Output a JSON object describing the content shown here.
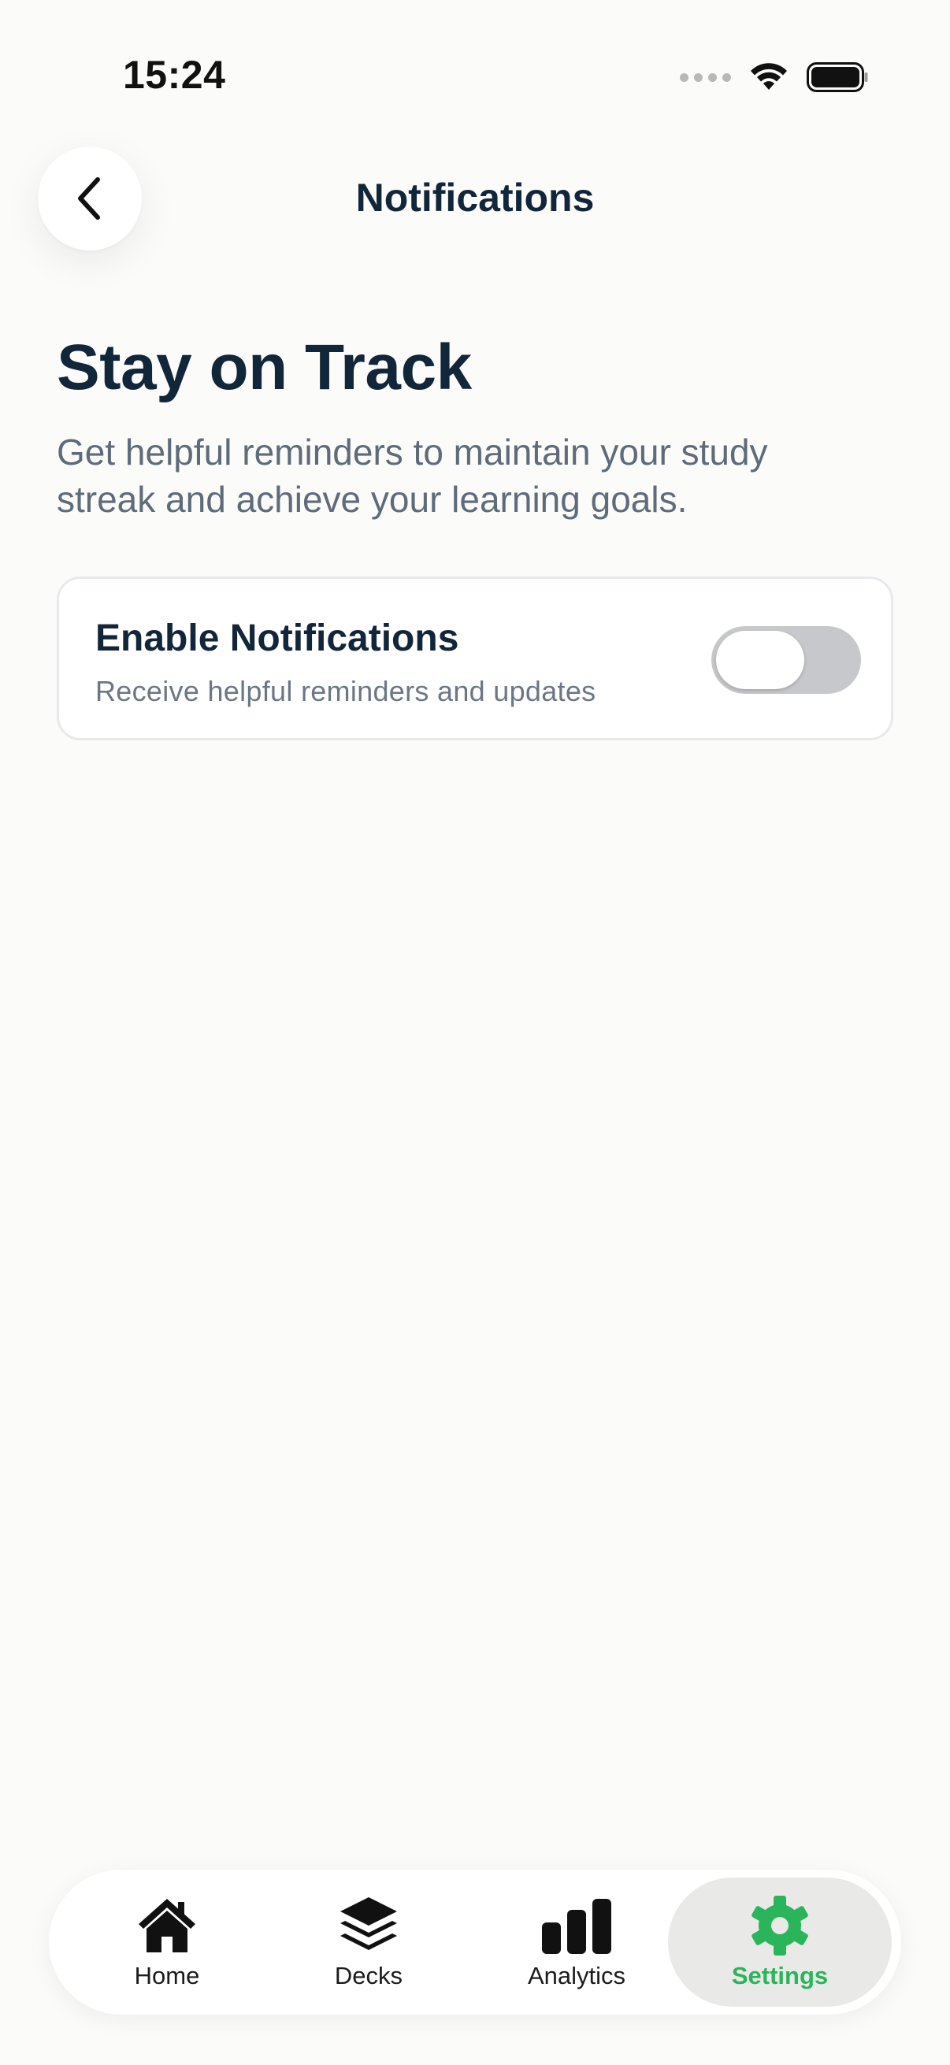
{
  "status_bar": {
    "time": "15:24",
    "icons": [
      "cellular-signal-icon",
      "wifi-icon",
      "battery-icon"
    ]
  },
  "header": {
    "title": "Notifications",
    "back_icon": "chevron-left-icon"
  },
  "hero": {
    "title": "Stay on Track",
    "subtitle": "Get helpful reminders to maintain your study streak and achieve your learning goals."
  },
  "notification_card": {
    "title": "Enable Notifications",
    "subtitle": "Receive helpful reminders and updates",
    "toggle_enabled": false
  },
  "tab_bar": {
    "active_tab": "Settings",
    "active_color": "#2bb55b",
    "tabs": [
      {
        "label": "Home",
        "icon": "home-icon"
      },
      {
        "label": "Decks",
        "icon": "layers-icon"
      },
      {
        "label": "Analytics",
        "icon": "bar-chart-icon"
      },
      {
        "label": "Settings",
        "icon": "gear-icon"
      }
    ]
  }
}
